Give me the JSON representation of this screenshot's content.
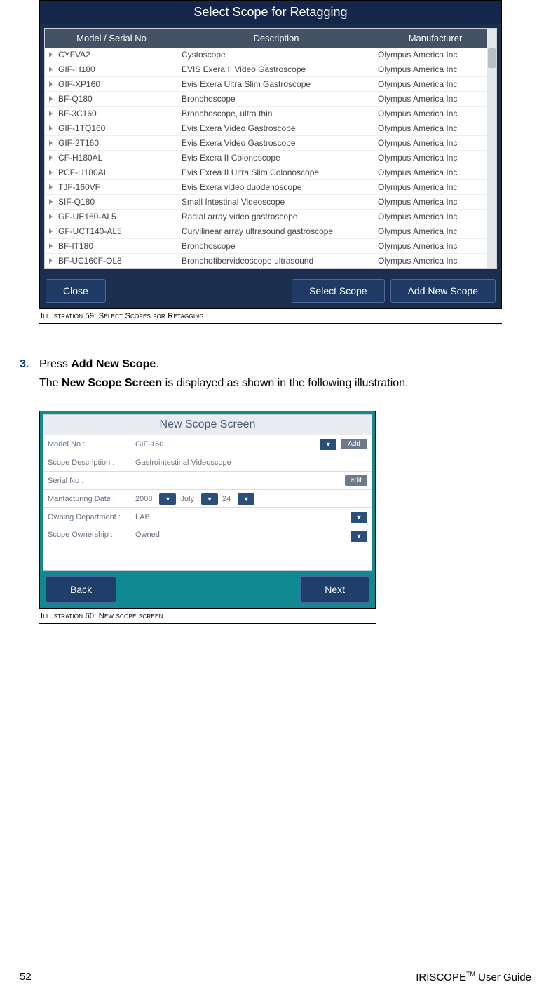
{
  "fig59": {
    "title": "Select Scope for Retagging",
    "headers": {
      "col1": "Model / Serial No",
      "col2": "Description",
      "col3": "Manufacturer"
    },
    "rows": [
      {
        "model": "CYFVA2",
        "desc": "Cystoscope",
        "mfr": "Olympus America Inc"
      },
      {
        "model": "GIF-H180",
        "desc": "EVIS Exera II Video Gastroscope",
        "mfr": "Olympus America Inc"
      },
      {
        "model": "GIF-XP160",
        "desc": "Evis Exera Ultra Slim Gastroscope",
        "mfr": "Olympus America Inc"
      },
      {
        "model": "BF-Q180",
        "desc": "Bronchoscope",
        "mfr": "Olympus America Inc"
      },
      {
        "model": "BF-3C160",
        "desc": "Bronchoscope, ultra thin",
        "mfr": "Olympus America Inc"
      },
      {
        "model": "GIF-1TQ160",
        "desc": "Evis Exera Video Gastroscope",
        "mfr": "Olympus America Inc"
      },
      {
        "model": "GIF-2T160",
        "desc": "Evis Exera Video Gastroscope",
        "mfr": "Olympus America Inc"
      },
      {
        "model": "CF-H180AL",
        "desc": "Evis Exera II Colonoscope",
        "mfr": "Olympus America Inc"
      },
      {
        "model": "PCF-H180AL",
        "desc": "Evis Exrea II Ultra Slim Colonoscope",
        "mfr": "Olympus America Inc"
      },
      {
        "model": "TJF-160VF",
        "desc": "Evis Exera video duodenoscope",
        "mfr": "Olympus America Inc"
      },
      {
        "model": "SIF-Q180",
        "desc": "Small Intestinal Videoscope",
        "mfr": "Olympus America Inc"
      },
      {
        "model": "GF-UE160-AL5",
        "desc": "Radial array video gastroscope",
        "mfr": "Olympus America Inc"
      },
      {
        "model": "GF-UCT140-AL5",
        "desc": "Curvilinear array ultrasound gastroscope",
        "mfr": "Olympus America Inc"
      },
      {
        "model": "BF-IT180",
        "desc": "Bronchoscope",
        "mfr": "Olympus America Inc"
      },
      {
        "model": "BF-UC160F-OL8",
        "desc": "Bronchofibervideoscope  ultrasound",
        "mfr": "Olympus America Inc"
      }
    ],
    "buttons": {
      "close": "Close",
      "select": "Select Scope",
      "add": "Add New Scope"
    },
    "caption": "Illustration 59: Select Scopes for Retagging"
  },
  "step": {
    "num": "3.",
    "line1_pre": "Press ",
    "line1_bold": "Add New Scope",
    "line1_post": ".",
    "line2_pre": "The ",
    "line2_bold": "New Scope Screen",
    "line2_post": " is displayed as shown in the following illustration."
  },
  "fig60": {
    "title": "New Scope Screen",
    "rows": {
      "model": {
        "label": "Model No :",
        "value": "GIF-160",
        "dd": "▼",
        "add": "Add"
      },
      "desc": {
        "label": "Scope Description :",
        "value": "Gastrointestinal Videoscope"
      },
      "serial": {
        "label": "Serial No :",
        "value": "",
        "edit": "edit"
      },
      "mfg": {
        "label": "Manfacturing Date :",
        "year": "2008",
        "month": "July",
        "day": "24",
        "dd": "▼"
      },
      "dept": {
        "label": "Owning Department :",
        "value": "LAB",
        "dd": "▼"
      },
      "own": {
        "label": "Scope Ownership :",
        "value": "Owned",
        "dd": "▼"
      }
    },
    "buttons": {
      "back": "Back",
      "next": "Next"
    },
    "caption": "Illustration 60: New scope screen"
  },
  "footer": {
    "page": "52",
    "guide_pre": "IRISCOPE",
    "guide_tm": "TM",
    "guide_post": " User Guide"
  }
}
